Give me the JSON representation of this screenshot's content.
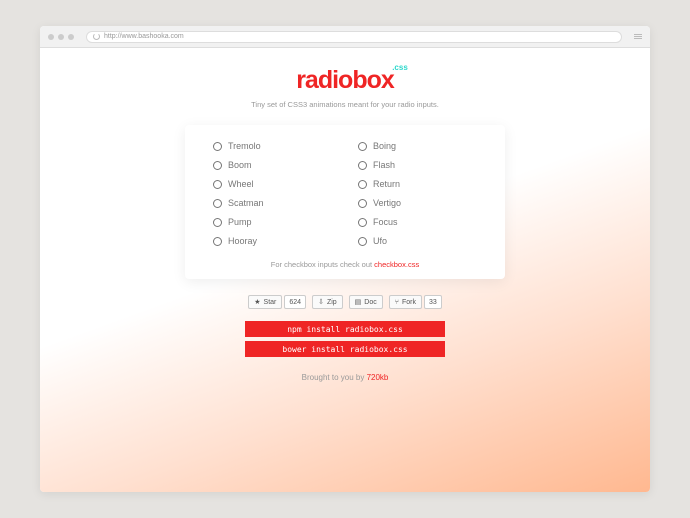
{
  "browser": {
    "url": "http://www.bashooka.com"
  },
  "logo": {
    "text": "radiobox",
    "sup": ".css"
  },
  "tagline": "Tiny set of CSS3 animations meant for your radio inputs.",
  "options": {
    "left": [
      "Tremolo",
      "Boom",
      "Wheel",
      "Scatman",
      "Pump",
      "Hooray"
    ],
    "right": [
      "Boing",
      "Flash",
      "Return",
      "Vertigo",
      "Focus",
      "Ufo"
    ]
  },
  "card_footer": {
    "prefix": "For checkbox inputs check out ",
    "link": "checkbox.css"
  },
  "gh": {
    "star": "Star",
    "star_count": "624",
    "zip": "Zip",
    "doc": "Doc",
    "fork": "Fork",
    "fork_count": "33"
  },
  "cmds": {
    "npm": "npm install radiobox.css",
    "bower": "bower install radiobox.css"
  },
  "credit": {
    "prefix": "Brought to you by ",
    "link": "720kb"
  }
}
